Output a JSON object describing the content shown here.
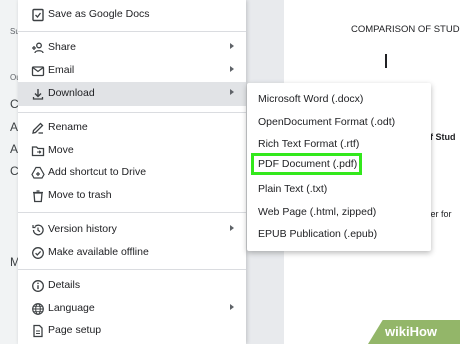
{
  "background_fragments": {
    "app_left": [
      "Su",
      "Ou",
      "Co",
      "Au",
      "Ab",
      "Co",
      "Mo"
    ],
    "doc_title": "COMPARISON OF STUDEN",
    "doc_frag_1": "f Stud",
    "doc_frag_2": "ter for"
  },
  "menu": {
    "items": [
      {
        "label": "Save as Google Docs",
        "icon": "google-docs-icon"
      },
      {
        "label": "Share",
        "icon": "add-person-icon",
        "submenu": true
      },
      {
        "label": "Email",
        "icon": "email-icon",
        "submenu": true
      },
      {
        "label": "Download",
        "icon": "download-icon",
        "submenu": true,
        "highlighted": true
      },
      {
        "label": "Rename",
        "icon": "pencil-icon"
      },
      {
        "label": "Move",
        "icon": "folder-icon"
      },
      {
        "label": "Add shortcut to Drive",
        "icon": "drive-shortcut-icon"
      },
      {
        "label": "Move to trash",
        "icon": "trash-icon"
      },
      {
        "label": "Version history",
        "icon": "history-icon",
        "submenu": true
      },
      {
        "label": "Make available offline",
        "icon": "offline-check-icon"
      },
      {
        "label": "Details",
        "icon": "info-icon"
      },
      {
        "label": "Language",
        "icon": "globe-icon",
        "submenu": true
      },
      {
        "label": "Page setup",
        "icon": "page-icon"
      }
    ]
  },
  "download_submenu": {
    "items": [
      {
        "label": "Microsoft Word (.docx)"
      },
      {
        "label": "OpenDocument Format (.odt)"
      },
      {
        "label": "Rich Text Format (.rtf)"
      },
      {
        "label": "PDF Document (.pdf)",
        "selected": true
      },
      {
        "label": "Plain Text (.txt)"
      },
      {
        "label": "Web Page (.html, zipped)"
      },
      {
        "label": "EPUB Publication (.epub)"
      }
    ],
    "highlight_color": "#33e81c"
  },
  "watermark": {
    "text": "wikiHow",
    "color": "#93b669"
  }
}
